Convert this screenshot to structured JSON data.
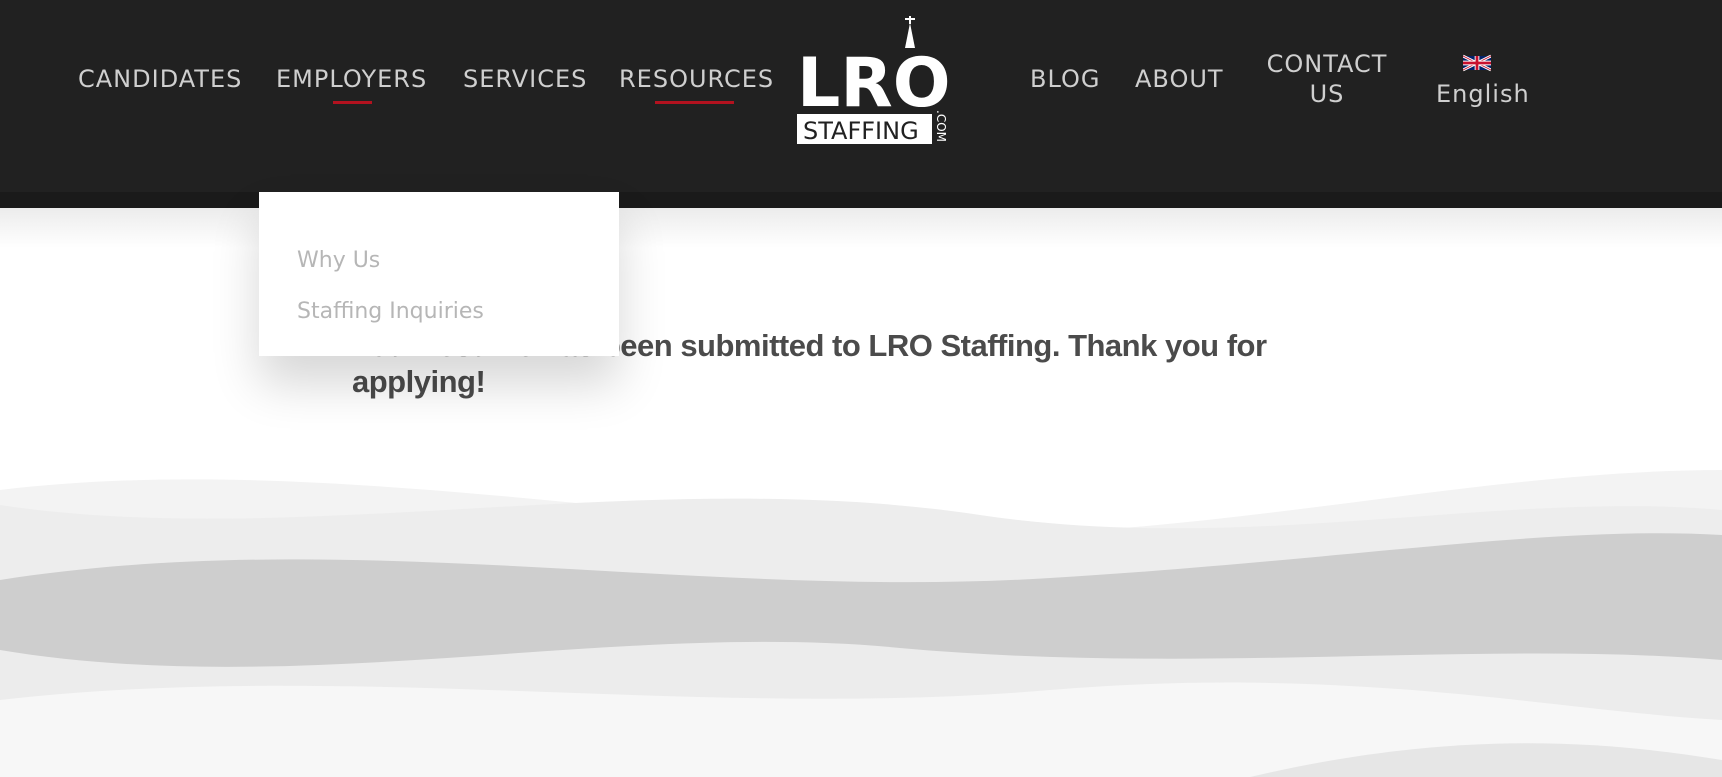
{
  "brand": {
    "logo_main": "LRO",
    "logo_sub": "STAFFING",
    "logo_suffix": ".COM",
    "accent_color": "#b3121f",
    "header_bg": "#212121"
  },
  "nav": {
    "left": [
      {
        "label": "CANDIDATES"
      },
      {
        "label": "EMPLOYERS"
      },
      {
        "label": "SERVICES"
      },
      {
        "label": "RESOURCES"
      }
    ],
    "right": [
      {
        "label": "BLOG"
      },
      {
        "label": "ABOUT"
      },
      {
        "label_line1": "CONTACT",
        "label_line2": "US"
      },
      {
        "label": "English",
        "icon": "uk-flag-icon"
      }
    ]
  },
  "dropdown": {
    "items": [
      {
        "label": "Why Us"
      },
      {
        "label": "Staffing Inquiries"
      }
    ]
  },
  "main": {
    "message": "Your resume has been submitted to LRO Staffing. Thank you for applying!"
  }
}
